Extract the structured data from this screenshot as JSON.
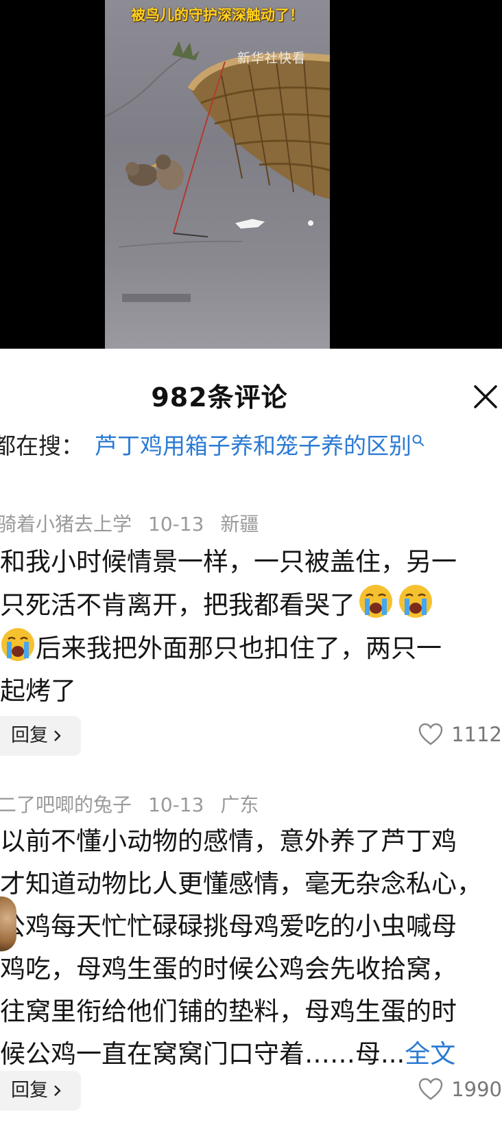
{
  "video": {
    "caption": "被鸟儿的守护深深触动了！",
    "watermark": "新华社快看"
  },
  "comments_panel": {
    "count_title": "982条评论",
    "search_prefix": "都在搜：",
    "search_query": "芦丁鸡用箱子养和笼子养的区别"
  },
  "comments": [
    {
      "user": "骑着小猪去上学",
      "date": "10-13",
      "location": "新疆",
      "lines": [
        "和我小时候情景一样，一只被盖住，另一",
        "只死活不肯离开，把我都看哭了",
        "后来我把外面那只也扣住了，两只一",
        "起烤了"
      ],
      "emoji": "loudly-crying-face",
      "reply_label": "回复",
      "likes": "1112"
    },
    {
      "user": "二了吧唧的兔子",
      "date": "10-13",
      "location": "广东",
      "lines": [
        "以前不懂小动物的感情，意外养了芦丁鸡",
        "才知道动物比人更懂感情，毫无杂念私心，",
        "公鸡每天忙忙碌碌挑母鸡爱吃的小虫喊母",
        "鸡吃，母鸡生蛋的时候公鸡会先收拾窝，",
        "往窝里衔给他们铺的垫料，母鸡生蛋的时",
        "候公鸡一直在窝窝门口守着……母..."
      ],
      "more_label": "全文",
      "reply_label": "回复",
      "likes": "1990"
    }
  ],
  "colors": {
    "link": "#2b7ad3",
    "meta": "#9a9a9a",
    "caption": "#ffd21f"
  }
}
